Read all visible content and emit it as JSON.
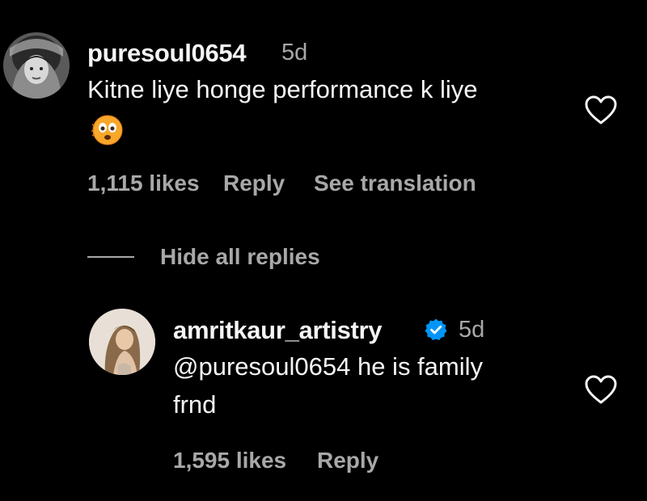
{
  "comment": {
    "username": "puresoul0654",
    "time": "5d",
    "text_line1": "Kitne liye honge performance k liye",
    "emoji": "🫨",
    "likes": "1,115 likes",
    "reply": "Reply",
    "see_translation": "See translation"
  },
  "replies_toggle": "Hide all replies",
  "reply": {
    "username": "amritkaur_artistry",
    "verified": true,
    "time": "5d",
    "text_line1": "@puresoul0654 he is family",
    "text_line2": "frnd",
    "likes": "1,595 likes",
    "reply": "Reply"
  },
  "colors": {
    "background": "#000000",
    "primary_text": "#f5f5f5",
    "secondary_text": "#a8a8a8",
    "verified_blue": "#0095f6"
  }
}
